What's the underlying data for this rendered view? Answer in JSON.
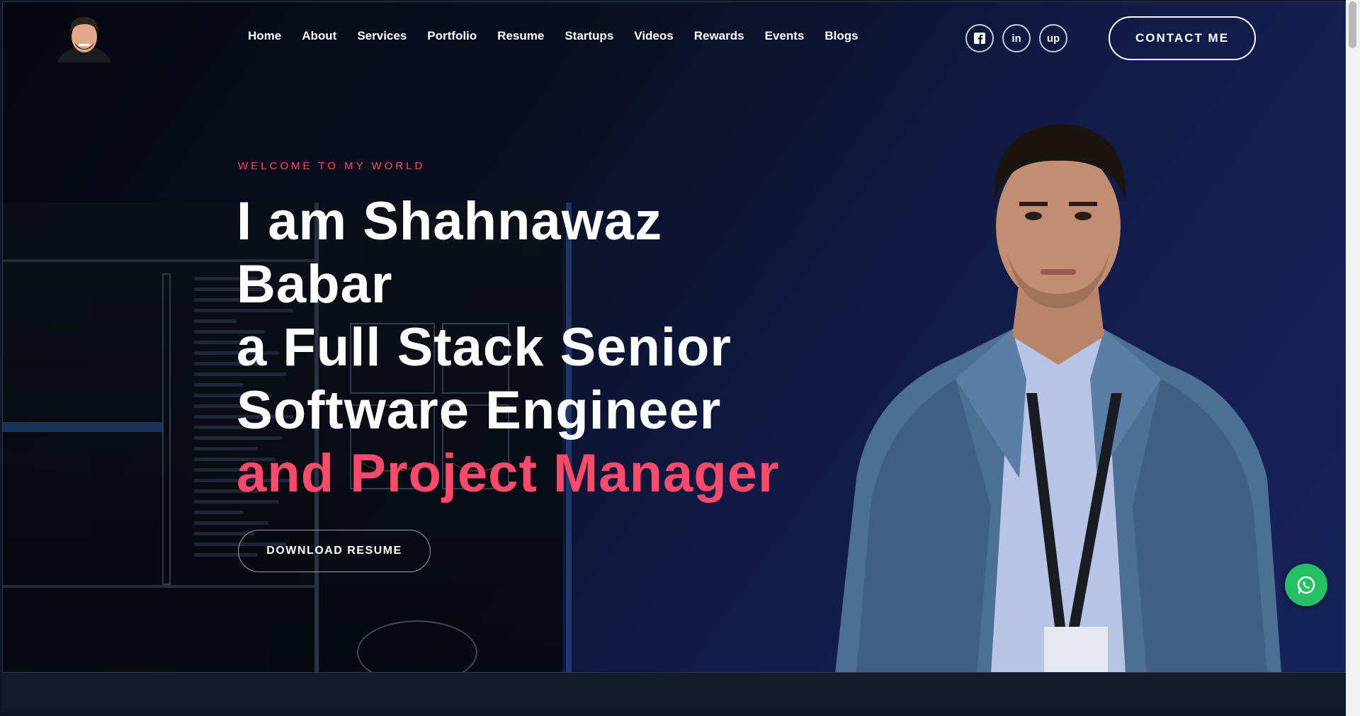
{
  "nav": {
    "links": [
      "Home",
      "About",
      "Services",
      "Portfolio",
      "Resume",
      "Startups",
      "Videos",
      "Rewards",
      "Events",
      "Blogs"
    ],
    "socials": [
      {
        "icon": "facebook-icon",
        "glyph": "f"
      },
      {
        "icon": "linkedin-icon",
        "glyph": "in"
      },
      {
        "icon": "upwork-icon",
        "glyph": "up"
      }
    ],
    "contact_label": "CONTACT ME"
  },
  "hero": {
    "eyebrow": "WELCOME TO MY WORLD",
    "line1": "I am Shahnawaz",
    "line2": "Babar",
    "line3": "a Full Stack Senior",
    "line4": "Software Engineer",
    "line5": "and Project Manager",
    "download_label": "DOWNLOAD RESUME"
  },
  "colors": {
    "accent": "#ff4a6b",
    "whatsapp": "#25c065",
    "background": "#0a0f22"
  }
}
